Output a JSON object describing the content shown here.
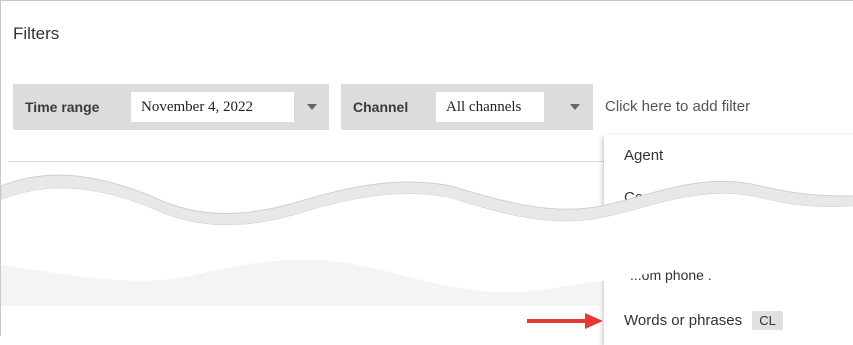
{
  "page": {
    "title": "Filters"
  },
  "filters": {
    "time_range": {
      "label": "Time range",
      "value": "November 4, 2022"
    },
    "channel": {
      "label": "Channel",
      "value": "All channels"
    },
    "add_filter_text": "Click here to add filter"
  },
  "dropdown": {
    "item_agent": "Agent",
    "item_cut_top": "Co",
    "item_cut_bottom": "...om phone .",
    "item_words": "Words or phrases",
    "item_words_badge": "CL"
  },
  "colors": {
    "chip_bg": "#dcdcdc",
    "arrow": "#e53935",
    "badge_bg": "#e0e0e0"
  }
}
